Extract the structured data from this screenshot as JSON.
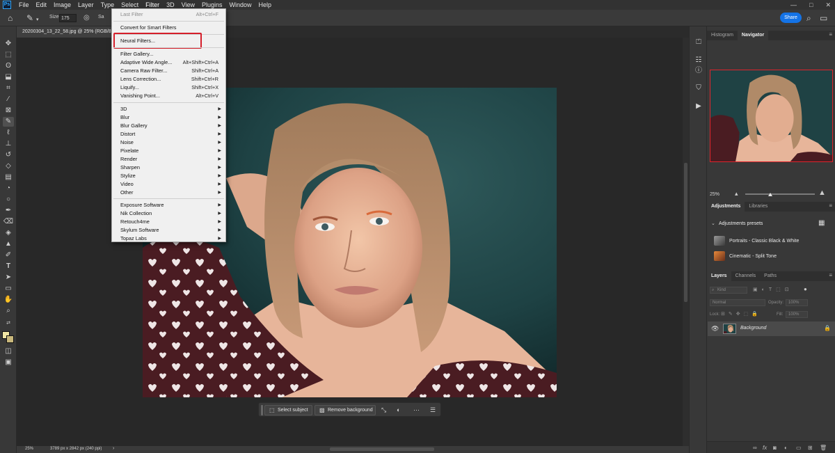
{
  "app": {
    "logo": "Ps",
    "menus": [
      "File",
      "Edit",
      "Image",
      "Layer",
      "Type",
      "Select",
      "Filter",
      "3D",
      "View",
      "Plugins",
      "Window",
      "Help"
    ],
    "active_menu": "Filter",
    "window_controls": [
      "—",
      "□",
      "✕"
    ]
  },
  "options": {
    "size_label": "Size",
    "size_value": "175",
    "sample_label": "Sa",
    "share_label": "Share",
    "icons": [
      "home-icon",
      "spot-healing-brush-icon",
      "brush-settings-icon",
      "search-icon",
      "workspace-icon"
    ]
  },
  "document": {
    "tab_title": "20200304_13_22_58.jpg @ 25% (RGB/8)"
  },
  "filter_menu": {
    "last_filter": "Last Filter",
    "last_filter_shortcut": "Alt+Ctrl+F",
    "convert": "Convert for Smart Filters",
    "neural": "Neural Filters...",
    "group1": [
      {
        "label": "Filter Gallery...",
        "shortcut": ""
      },
      {
        "label": "Adaptive Wide Angle...",
        "shortcut": "Alt+Shift+Ctrl+A"
      },
      {
        "label": "Camera Raw Filter...",
        "shortcut": "Shift+Ctrl+A"
      },
      {
        "label": "Lens Correction...",
        "shortcut": "Shift+Ctrl+R"
      },
      {
        "label": "Liquify...",
        "shortcut": "Shift+Ctrl+X"
      },
      {
        "label": "Vanishing Point...",
        "shortcut": "Alt+Ctrl+V"
      }
    ],
    "group2": [
      "3D",
      "Blur",
      "Blur Gallery",
      "Distort",
      "Noise",
      "Pixelate",
      "Render",
      "Sharpen",
      "Stylize",
      "Video",
      "Other"
    ],
    "group3": [
      "Exposure Software",
      "Nik Collection",
      "Retouch4me",
      "Skylum Software",
      "Topaz Labs"
    ]
  },
  "taskbar": {
    "select_subject": "Select subject",
    "remove_background": "Remove background"
  },
  "status": {
    "zoom": "25%",
    "dimensions": "3789 px x 2842 px (240 ppi)"
  },
  "panels": {
    "top_tabs": [
      "Histogram",
      "Navigator"
    ],
    "active_top_tab": "Navigator",
    "zoom_text": "25%",
    "zoom_level": 0.36,
    "adjust_tabs": [
      "Adjustments",
      "Libraries"
    ],
    "presets_header": "Adjustments presets",
    "presets": [
      "Portraits - Classic Black & White",
      "Cinematic - Split Tone"
    ],
    "layer_tabs": [
      "Layers",
      "Channels",
      "Paths"
    ],
    "kind_label": "Kind",
    "blend_mode": "Normal",
    "opacity_label": "Opacity:",
    "opacity_value": "100%",
    "lock_label": "Lock:",
    "fill_label": "Fill:",
    "fill_value": "100%",
    "layer_name": "Background"
  },
  "colors": {
    "accent": "#1473e6",
    "highlight": "#d51e2a",
    "foreground": "#f1e6a4",
    "background": "#c9b87c"
  }
}
